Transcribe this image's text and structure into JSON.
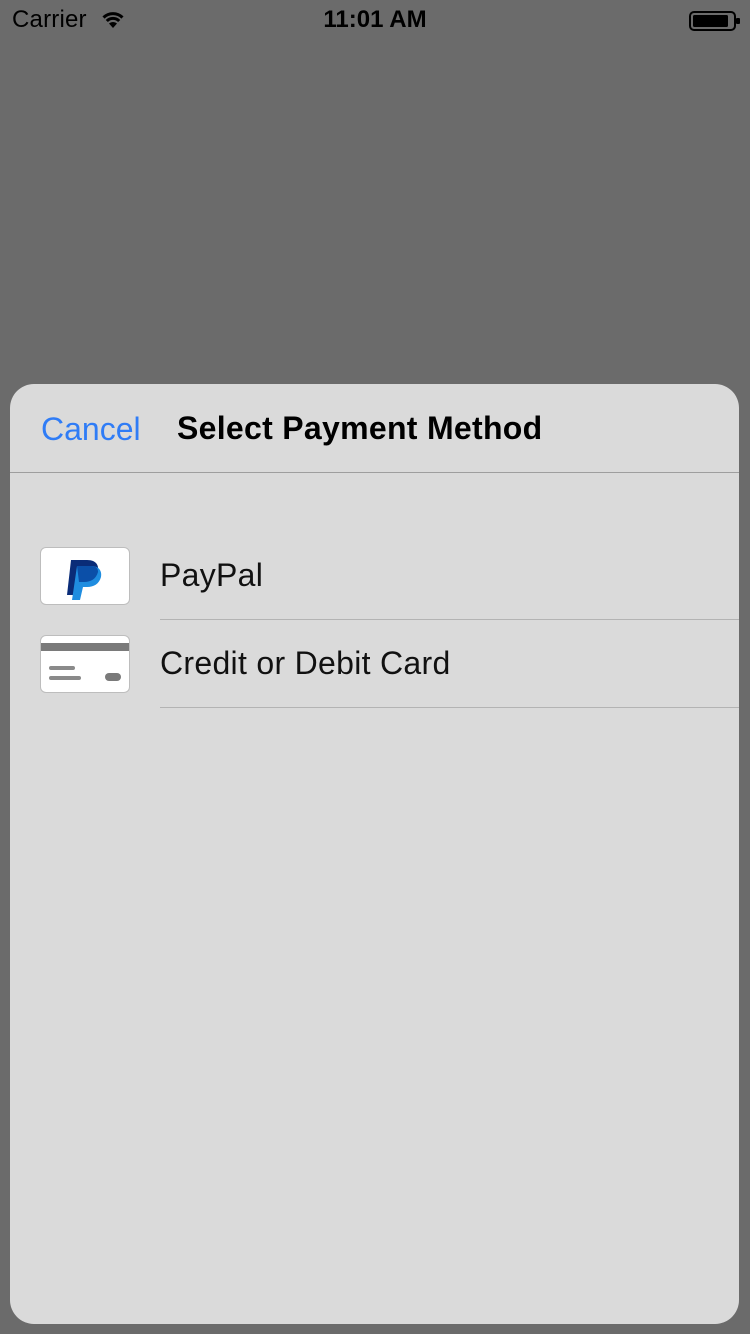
{
  "status_bar": {
    "carrier": "Carrier",
    "time": "11:01 AM",
    "icons": [
      "wifi-icon",
      "battery-icon"
    ]
  },
  "sheet": {
    "cancel_label": "Cancel",
    "title": "Select Payment Method",
    "methods": [
      {
        "label": "PayPal",
        "icon": "paypal-logo-icon"
      },
      {
        "label": "Credit or Debit Card",
        "icon": "credit-card-icon"
      }
    ]
  },
  "colors": {
    "backdrop": "#6b6b6b",
    "sheet_background": "#dadada",
    "accent": "#2f7cf6",
    "paypal_dark": "#0a2c78",
    "paypal_light": "#1f8de0"
  }
}
